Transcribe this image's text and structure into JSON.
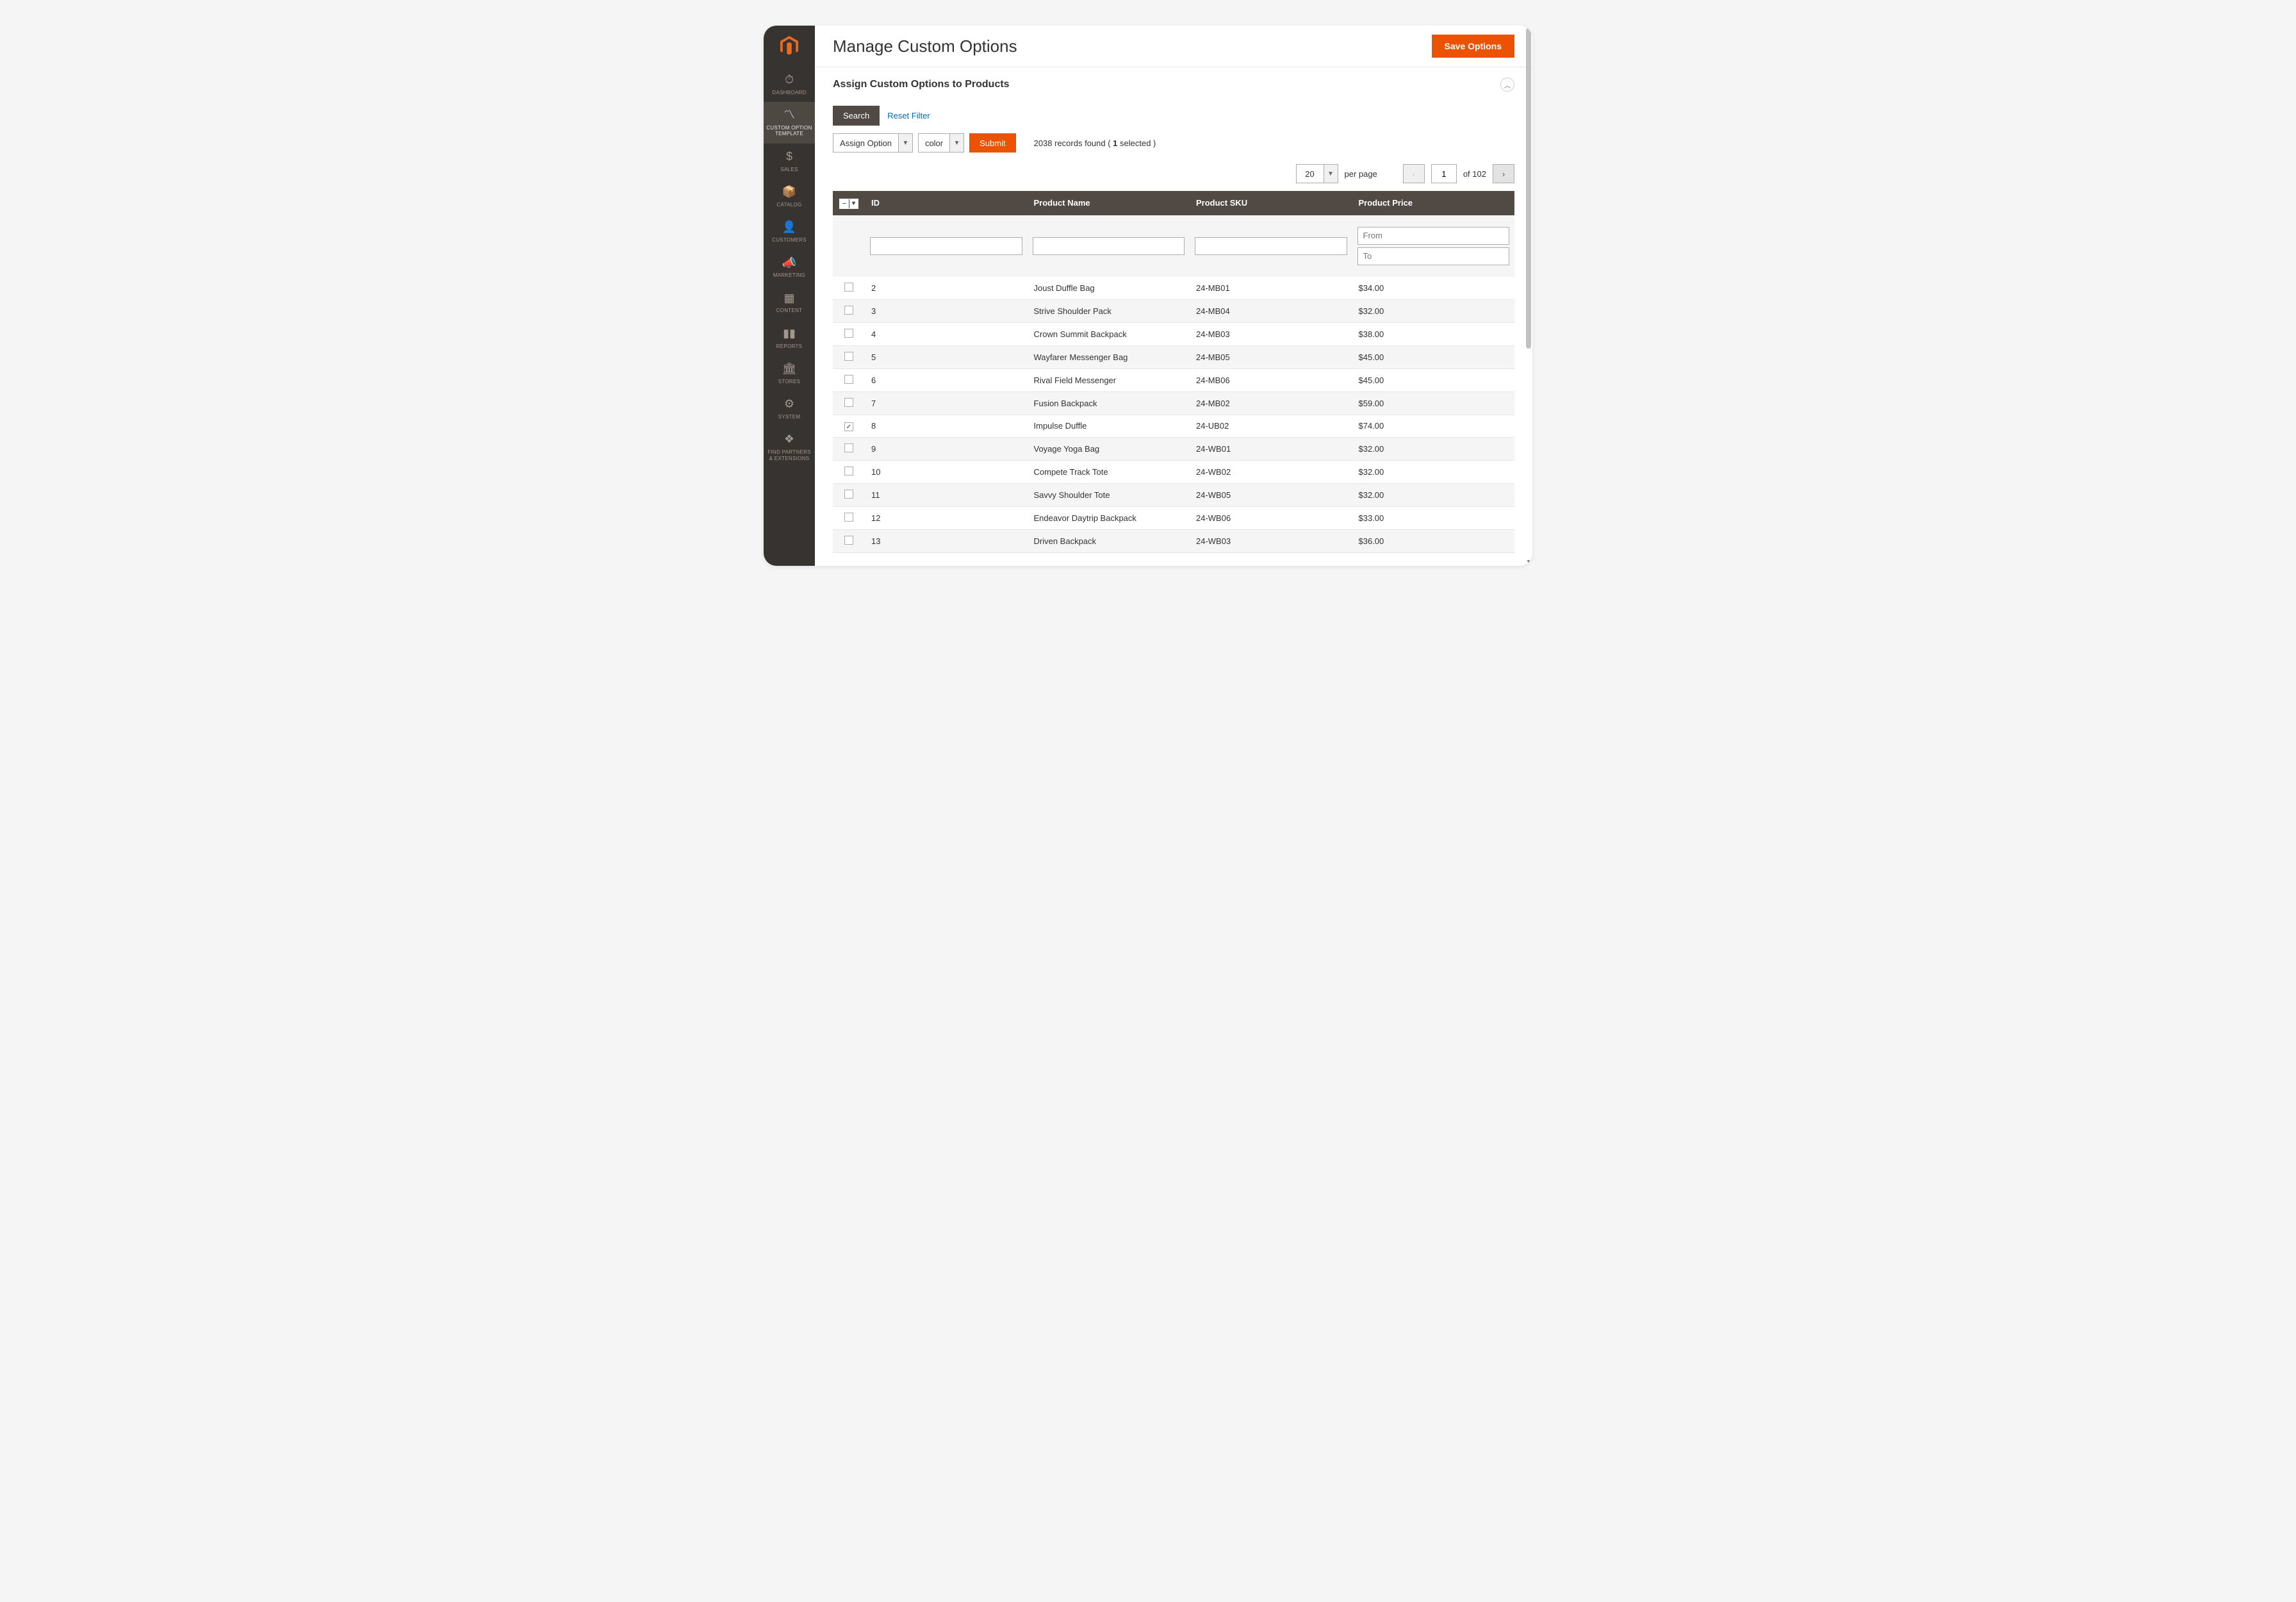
{
  "page": {
    "title": "Manage Custom Options",
    "save_button": "Save Options"
  },
  "section": {
    "title": "Assign Custom Options to Products"
  },
  "sidebar": {
    "items": [
      {
        "label": "DASHBOARD",
        "icon": "dashboard"
      },
      {
        "label": "CUSTOM OPTION TEMPLATE",
        "icon": "template",
        "active": true
      },
      {
        "label": "SALES",
        "icon": "sales"
      },
      {
        "label": "CATALOG",
        "icon": "catalog"
      },
      {
        "label": "CUSTOMERS",
        "icon": "customers"
      },
      {
        "label": "MARKETING",
        "icon": "marketing"
      },
      {
        "label": "CONTENT",
        "icon": "content"
      },
      {
        "label": "REPORTS",
        "icon": "reports"
      },
      {
        "label": "STORES",
        "icon": "stores"
      },
      {
        "label": "SYSTEM",
        "icon": "system"
      },
      {
        "label": "FIND PARTNERS & EXTENSIONS",
        "icon": "partners"
      }
    ]
  },
  "filters": {
    "search_button": "Search",
    "reset_link": "Reset Filter",
    "assign_option_label": "Assign Option",
    "color_label": "color",
    "submit_button": "Submit",
    "records_prefix": "2038 records found ( ",
    "selected_count": "1",
    "records_suffix": " selected )",
    "per_page_value": "20",
    "per_page_label": "per page",
    "page_current": "1",
    "page_total_prefix": "of ",
    "page_total": "102",
    "price_from_placeholder": "From",
    "price_to_placeholder": "To"
  },
  "grid": {
    "columns": [
      "ID",
      "Product Name",
      "Product SKU",
      "Product Price"
    ],
    "col_id": "ID",
    "col_name": "Product Name",
    "col_sku": "Product SKU",
    "col_price": "Product Price",
    "rows": [
      {
        "checked": false,
        "id": "2",
        "name": "Joust Duffle Bag",
        "sku": "24-MB01",
        "price": "$34.00"
      },
      {
        "checked": false,
        "id": "3",
        "name": "Strive Shoulder Pack",
        "sku": "24-MB04",
        "price": "$32.00"
      },
      {
        "checked": false,
        "id": "4",
        "name": "Crown Summit Backpack",
        "sku": "24-MB03",
        "price": "$38.00"
      },
      {
        "checked": false,
        "id": "5",
        "name": "Wayfarer Messenger Bag",
        "sku": "24-MB05",
        "price": "$45.00"
      },
      {
        "checked": false,
        "id": "6",
        "name": "Rival Field Messenger",
        "sku": "24-MB06",
        "price": "$45.00"
      },
      {
        "checked": false,
        "id": "7",
        "name": "Fusion Backpack",
        "sku": "24-MB02",
        "price": "$59.00"
      },
      {
        "checked": true,
        "id": "8",
        "name": "Impulse Duffle",
        "sku": "24-UB02",
        "price": "$74.00"
      },
      {
        "checked": false,
        "id": "9",
        "name": "Voyage Yoga Bag",
        "sku": "24-WB01",
        "price": "$32.00"
      },
      {
        "checked": false,
        "id": "10",
        "name": "Compete Track Tote",
        "sku": "24-WB02",
        "price": "$32.00"
      },
      {
        "checked": false,
        "id": "11",
        "name": "Savvy Shoulder Tote",
        "sku": "24-WB05",
        "price": "$32.00"
      },
      {
        "checked": false,
        "id": "12",
        "name": "Endeavor Daytrip Backpack",
        "sku": "24-WB06",
        "price": "$33.00"
      },
      {
        "checked": false,
        "id": "13",
        "name": "Driven Backpack",
        "sku": "24-WB03",
        "price": "$36.00"
      }
    ]
  },
  "icons": {
    "dashboard": "⏱",
    "template": "〽",
    "sales": "$",
    "catalog": "📦",
    "customers": "👤",
    "marketing": "📣",
    "content": "▦",
    "reports": "▮▮",
    "stores": "🏛",
    "system": "⚙",
    "partners": "❖"
  }
}
